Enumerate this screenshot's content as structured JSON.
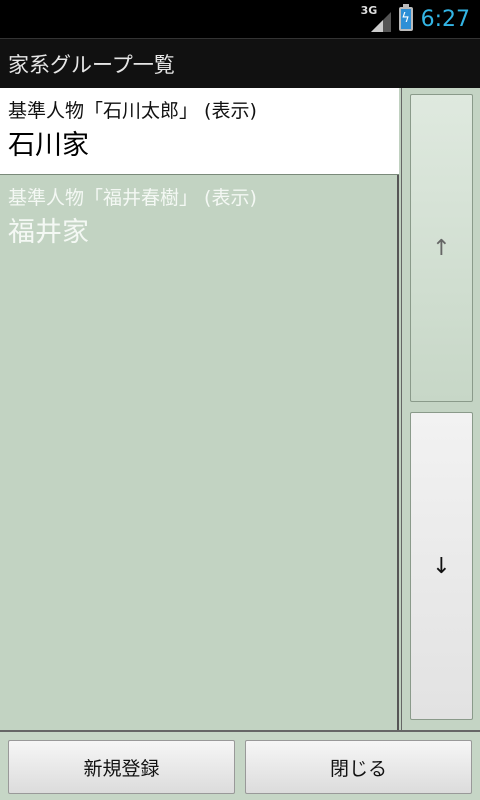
{
  "status_bar": {
    "network_type": "3G",
    "time": "6:27"
  },
  "header": {
    "title": "家系グループ一覧"
  },
  "list": {
    "items": [
      {
        "line1": "基準人物「石川太郎」 (表示)",
        "line2": "石川家",
        "selected": true
      },
      {
        "line1": "基準人物「福井春樹」 (表示)",
        "line2": "福井家",
        "selected": false
      }
    ]
  },
  "scroll": {
    "up_label": "↑",
    "down_label": "↓"
  },
  "footer": {
    "new_label": "新規登録",
    "close_label": "閉じる"
  }
}
